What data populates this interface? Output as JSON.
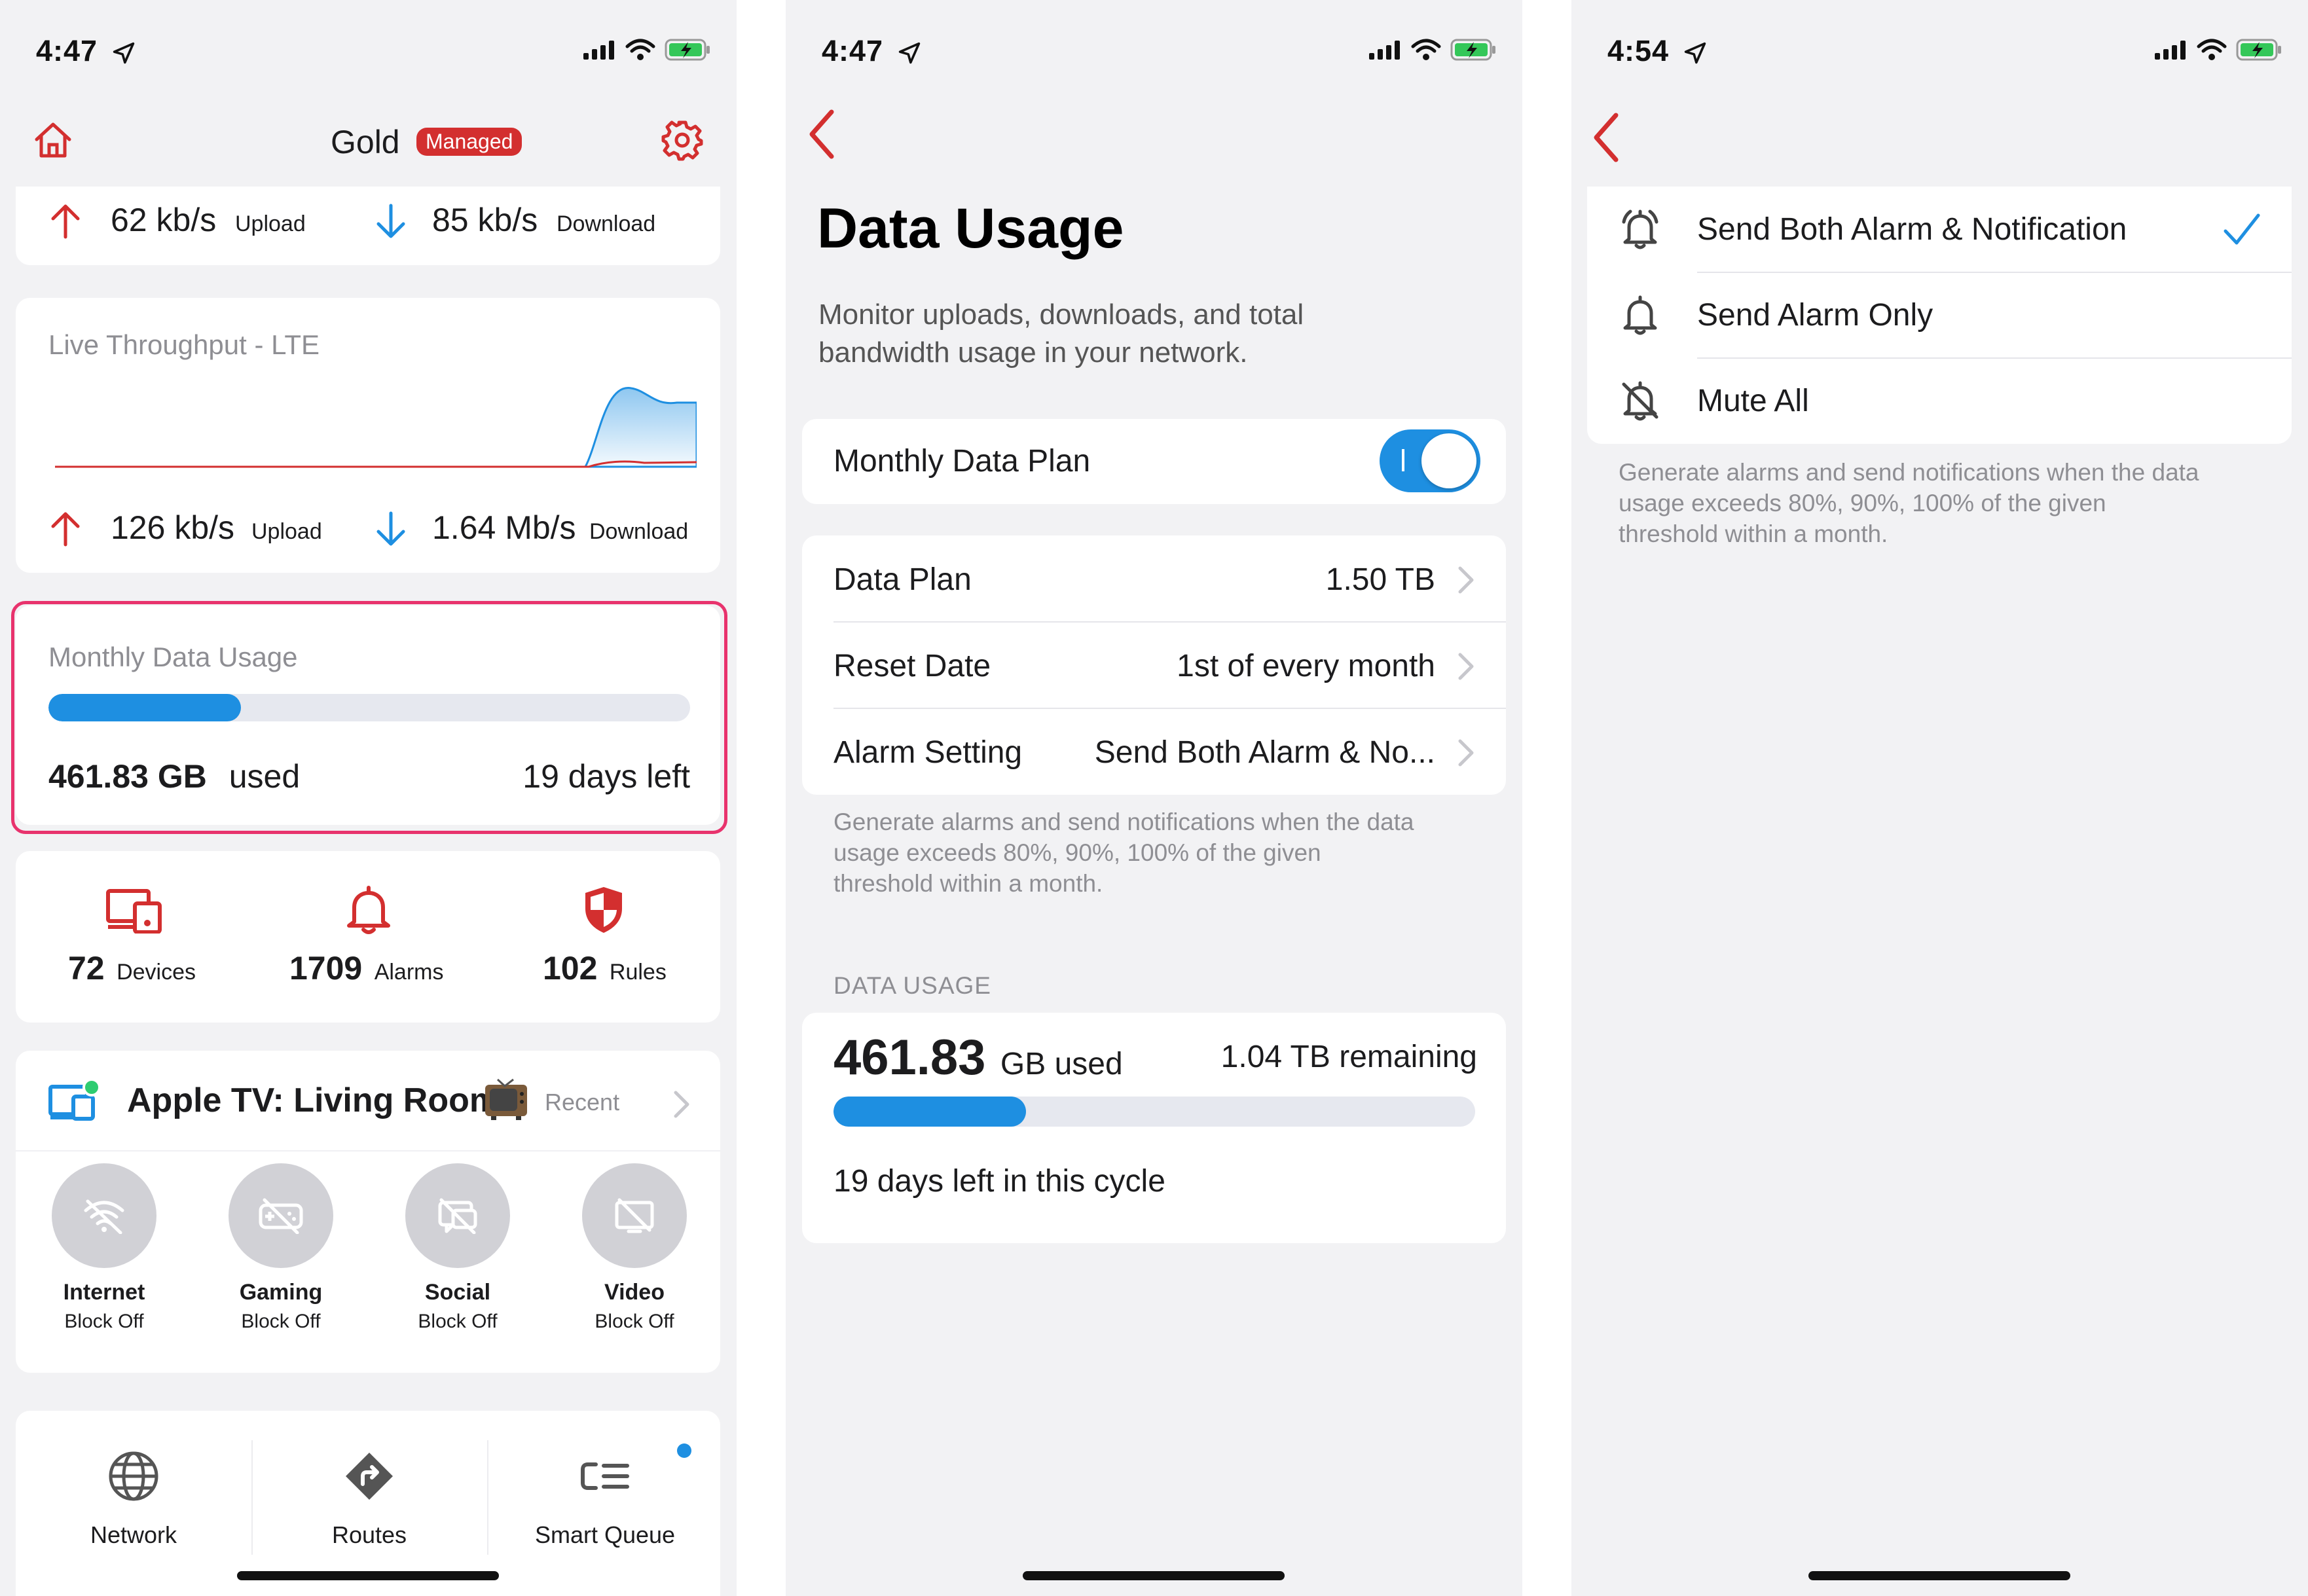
{
  "screen1": {
    "status": {
      "time": "4:47"
    },
    "header": {
      "title": "Gold",
      "badge": "Managed"
    },
    "speed_top": {
      "upload_value": "62 kb/s",
      "upload_label": "Upload",
      "download_value": "85 kb/s",
      "download_label": "Download"
    },
    "throughput": {
      "title": "Live Throughput - LTE",
      "upload_value": "126 kb/s",
      "upload_label": "Upload",
      "download_value": "1.64 Mb/s",
      "download_label": "Download"
    },
    "monthly": {
      "title": "Monthly Data Usage",
      "used_value": "461.83 GB",
      "used_label": "used",
      "days_left": "19 days left",
      "progress": 0.3
    },
    "stats": [
      {
        "value": "72",
        "label": "Devices",
        "icon": "devices-icon"
      },
      {
        "value": "1709",
        "label": "Alarms",
        "icon": "bell-icon"
      },
      {
        "value": "102",
        "label": "Rules",
        "icon": "shield-icon"
      }
    ],
    "device": {
      "name": "Apple TV: Living Room",
      "recent": "Recent",
      "blocks": [
        {
          "name": "Internet",
          "status": "Block Off",
          "icon": "wifi-off-icon"
        },
        {
          "name": "Gaming",
          "status": "Block Off",
          "icon": "gaming-off-icon"
        },
        {
          "name": "Social",
          "status": "Block Off",
          "icon": "social-off-icon"
        },
        {
          "name": "Video",
          "status": "Block Off",
          "icon": "video-off-icon"
        }
      ]
    },
    "bottom_nav": [
      {
        "label": "Network",
        "icon": "globe-icon"
      },
      {
        "label": "Routes",
        "icon": "route-icon"
      },
      {
        "label": "Smart Queue",
        "icon": "smart-queue-icon"
      }
    ],
    "colors": {
      "accent_red": "#d32f2f",
      "blue": "#1e8fe1",
      "highlight": "#e8336d"
    }
  },
  "screen2": {
    "status": {
      "time": "4:47"
    },
    "title": "Data Usage",
    "subtitle_line1": "Monitor uploads, downloads, and total",
    "subtitle_line2": "bandwidth usage in your network.",
    "toggle": {
      "label": "Monthly Data Plan",
      "on": true
    },
    "rows": [
      {
        "label": "Data Plan",
        "value": "1.50 TB"
      },
      {
        "label": "Reset Date",
        "value": "1st of every month"
      },
      {
        "label": "Alarm Setting",
        "value": "Send Both Alarm & No..."
      }
    ],
    "note_line1": "Generate alarms and send notifications when the data",
    "note_line2": "usage exceeds 80%, 90%, 100% of the given",
    "note_line3": "threshold within a month.",
    "section_header": "DATA USAGE",
    "usage": {
      "used_number": "461.83",
      "used_unit": "GB used",
      "remaining": "1.04 TB remaining",
      "progress": 0.3,
      "cycle": "19 days left in this cycle"
    }
  },
  "screen3": {
    "status": {
      "time": "4:54"
    },
    "options": [
      {
        "label": "Send Both Alarm & Notification",
        "icon": "alarm-ringing-icon",
        "selected": true
      },
      {
        "label": "Send Alarm Only",
        "icon": "bell-icon",
        "selected": false
      },
      {
        "label": "Mute All",
        "icon": "bell-off-icon",
        "selected": false
      }
    ],
    "note_line1": "Generate alarms and send notifications when the data",
    "note_line2": "usage exceeds 80%, 90%, 100% of the given",
    "note_line3": "threshold within a month."
  }
}
